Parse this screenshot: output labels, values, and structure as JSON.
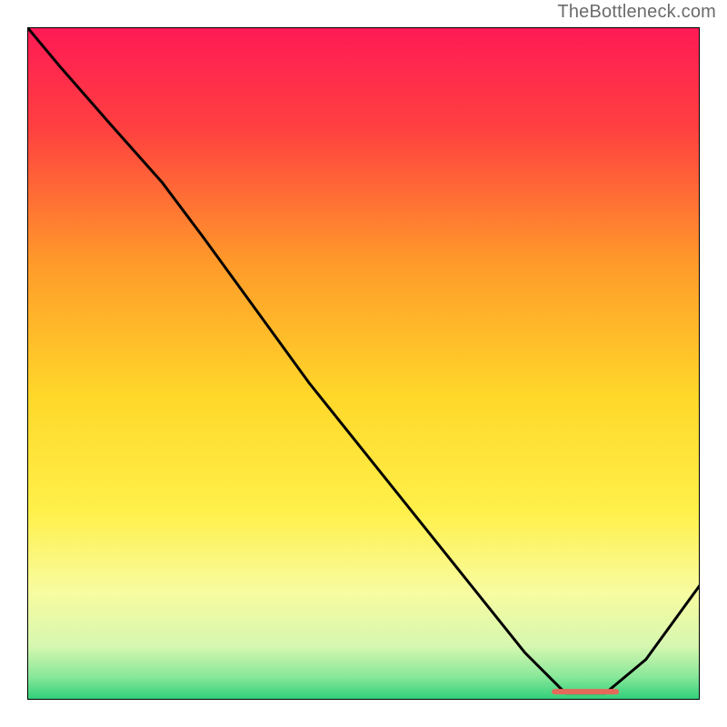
{
  "watermark": "TheBottleneck.com",
  "chart_data": {
    "type": "line",
    "title": "",
    "xlabel": "",
    "ylabel": "",
    "xlim": [
      0,
      100
    ],
    "ylim": [
      0,
      100
    ],
    "background_gradient": {
      "orientation": "vertical",
      "stops": [
        {
          "pos": 0.0,
          "color": "#ff1a56"
        },
        {
          "pos": 0.15,
          "color": "#ff4040"
        },
        {
          "pos": 0.35,
          "color": "#ff9a2a"
        },
        {
          "pos": 0.55,
          "color": "#ffd82a"
        },
        {
          "pos": 0.72,
          "color": "#fff04a"
        },
        {
          "pos": 0.84,
          "color": "#f8fca0"
        },
        {
          "pos": 0.92,
          "color": "#d6f7b0"
        },
        {
          "pos": 0.965,
          "color": "#8ae89a"
        },
        {
          "pos": 1.0,
          "color": "#2ecf7a"
        }
      ]
    },
    "series": [
      {
        "name": "bottleneck-curve",
        "color": "#000000",
        "x": [
          0,
          5,
          12,
          20,
          26,
          34,
          42,
          50,
          58,
          66,
          74,
          80,
          86,
          92,
          100
        ],
        "values": [
          100,
          94,
          86,
          77,
          69,
          58,
          47,
          37,
          27,
          17,
          7,
          1,
          1,
          6,
          17
        ]
      }
    ],
    "annotations": [
      {
        "name": "optimal-zone",
        "type": "marker-band",
        "x_start": 78,
        "x_end": 88,
        "y": 1.2,
        "color": "#e36a5a"
      }
    ]
  }
}
